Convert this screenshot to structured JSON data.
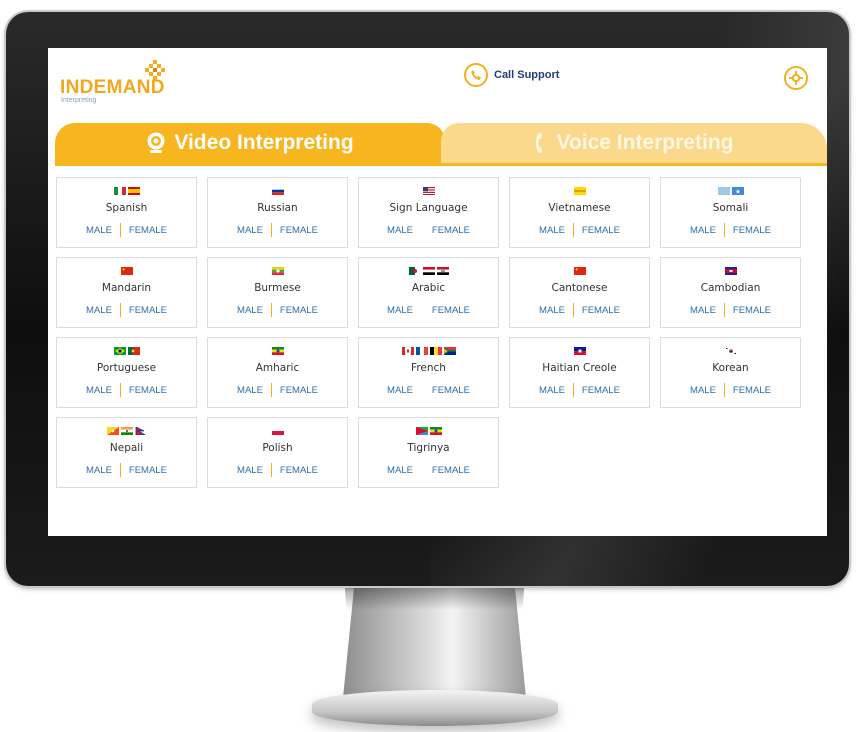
{
  "header": {
    "logo_text": "INDEMAND",
    "logo_subtext": "Interpreting",
    "support_label": "Call Support"
  },
  "tabs": [
    {
      "label": "Video Interpreting",
      "active": true
    },
    {
      "label": "Voice Interpreting",
      "active": false
    }
  ],
  "colors": {
    "accent": "#f7b520",
    "accent_light": "#fbd98c",
    "link": "#2a6fa8",
    "brand_blue": "#1f3f7a"
  },
  "gender_labels": {
    "male": "MALE",
    "female": "FEMALE"
  },
  "languages": [
    {
      "name": "Spanish",
      "flags": [
        "mexico",
        "spain"
      ]
    },
    {
      "name": "Russian",
      "flags": [
        "russia"
      ]
    },
    {
      "name": "Sign Language",
      "flags": [
        "usa"
      ]
    },
    {
      "name": "Vietnamese",
      "flags": [
        "yellow"
      ]
    },
    {
      "name": "Somali",
      "flags": [
        "somalia-light",
        "somalia"
      ]
    },
    {
      "name": "Mandarin",
      "flags": [
        "china"
      ]
    },
    {
      "name": "Burmese",
      "flags": [
        "myanmar"
      ]
    },
    {
      "name": "Arabic",
      "flags": [
        "algeria",
        "egypt",
        "iraq"
      ]
    },
    {
      "name": "Cantonese",
      "flags": [
        "china"
      ]
    },
    {
      "name": "Cambodian",
      "flags": [
        "cambodia"
      ]
    },
    {
      "name": "Portuguese",
      "flags": [
        "brazil",
        "portugal"
      ]
    },
    {
      "name": "Amharic",
      "flags": [
        "ethiopia"
      ]
    },
    {
      "name": "French",
      "flags": [
        "canada",
        "france",
        "belgium",
        "south-africa"
      ]
    },
    {
      "name": "Haitian Creole",
      "flags": [
        "haiti"
      ]
    },
    {
      "name": "Korean",
      "flags": [
        "korea"
      ]
    },
    {
      "name": "Nepali",
      "flags": [
        "bhutan",
        "india",
        "nepal"
      ]
    },
    {
      "name": "Polish",
      "flags": [
        "poland"
      ]
    },
    {
      "name": "Tigrinya",
      "flags": [
        "eritrea",
        "ethiopia"
      ]
    }
  ]
}
